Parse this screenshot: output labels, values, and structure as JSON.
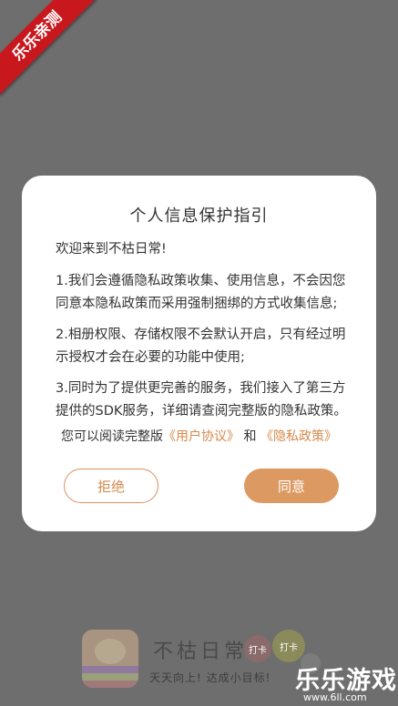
{
  "ribbon": {
    "text": "乐乐亲测"
  },
  "dialog": {
    "title": "个人信息保护指引",
    "welcome": "欢迎来到不枯日常!",
    "paragraphs": [
      "1.我们会遵循隐私政策收集、使用信息，不会因您同意本隐私政策而采用强制捆绑的方式收集信息;",
      "2.相册权限、存储权限不会默认开启，只有经过明示授权才会在必要的功能中使用;",
      "3.同时为了提供更完善的服务，我们接入了第三方提供的SDK服务，详细请查阅完整版的隐私政策。"
    ],
    "read_prefix": "您可以阅读完整版",
    "user_agreement_link": "《用户协议》",
    "and_text": "和",
    "privacy_policy_link": "《隐私政策》",
    "reject_label": "拒绝",
    "agree_label": "同意"
  },
  "splash": {
    "app_name": "不枯日常",
    "bubble_a": "打卡",
    "bubble_b": "打卡",
    "slogan": "天天向上! 达成小目标!"
  },
  "watermark": {
    "main": "乐乐游戏",
    "url": "www.6ll.com"
  },
  "colors": {
    "accent": "#dc9a62",
    "ribbon": "#c8181e",
    "overlay": "#6e6e6e"
  }
}
